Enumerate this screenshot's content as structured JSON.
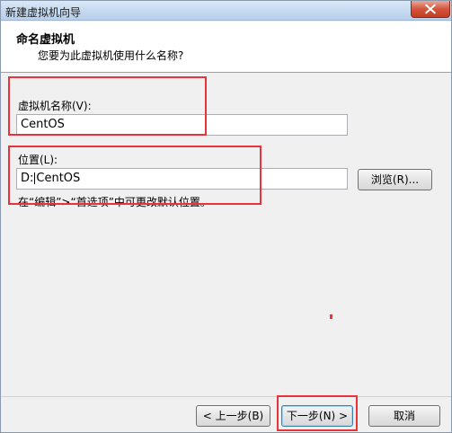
{
  "window": {
    "title": "新建虚拟机向导"
  },
  "header": {
    "title": "命名虚拟机",
    "subtitle": "您要为此虚拟机使用什么名称?"
  },
  "form": {
    "name_label": "虚拟机名称(V):",
    "name_value": "CentOS",
    "location_label": "位置(L):",
    "location_value_prefix": "D:",
    "location_value_suffix": "CentOS",
    "browse_label": "浏览(R)...",
    "hint": "在“编辑”>“首选项”中可更改默认位置。"
  },
  "footer": {
    "back_label": "< 上一步(B)",
    "next_label": "下一步(N) >",
    "cancel_label": "取消"
  },
  "colors": {
    "highlight": "#e8333b",
    "titlebar": "#c6daf0",
    "close": "#c23d22"
  }
}
